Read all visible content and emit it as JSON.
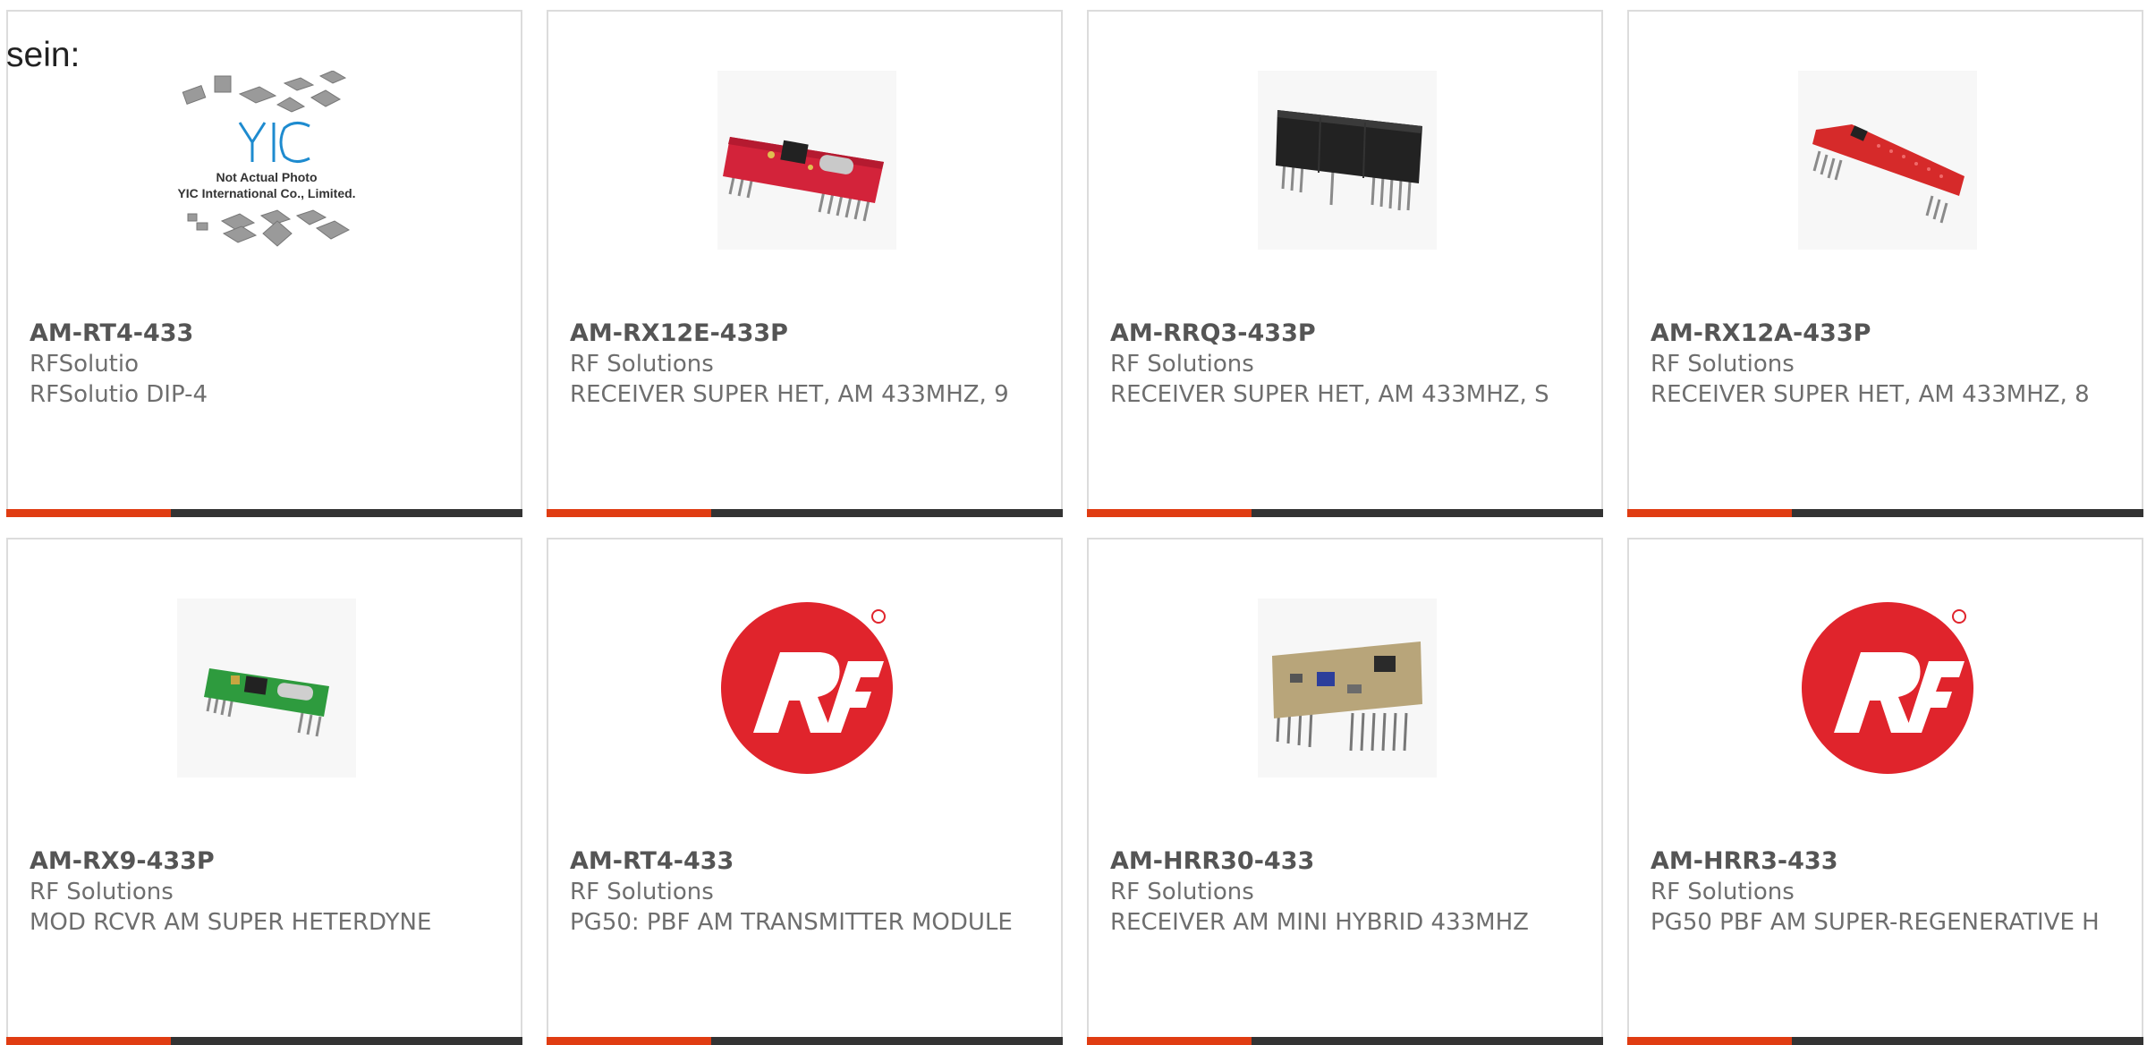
{
  "intro_text": "sein:",
  "accent_color": "#e03c12",
  "bar_color": "#333333",
  "products": [
    {
      "part": "AM-RT4-433",
      "manufacturer": "RFSolutio",
      "description": "RFSolutio DIP-4",
      "image": "yic-placeholder-photo",
      "image_text_line1": "Not Actual Photo",
      "image_text_line2": "YIC International Co., Limited.",
      "image_logo": "YIC"
    },
    {
      "part": "AM-RX12E-433P",
      "manufacturer": "RF Solutions",
      "description": "RECEIVER SUPER HET, AM 433MHZ, 9",
      "image": "red-receiver-module"
    },
    {
      "part": "AM-RRQ3-433P",
      "manufacturer": "RF Solutions",
      "description": "RECEIVER SUPER HET, AM 433MHZ, S",
      "image": "black-sip-module"
    },
    {
      "part": "AM-RX12A-433P",
      "manufacturer": "RF Solutions",
      "description": "RECEIVER SUPER HET, AM 433MHZ, 8",
      "image": "red-long-module"
    },
    {
      "part": "AM-RX9-433P",
      "manufacturer": "RF Solutions",
      "description": "MOD RCVR AM SUPER HETERDYNE",
      "image": "green-receiver-module"
    },
    {
      "part": "AM-RT4-433",
      "manufacturer": "RF Solutions",
      "description": "PG50: PBF AM TRANSMITTER MODULE",
      "image": "rf-solutions-logo"
    },
    {
      "part": "AM-HRR30-433",
      "manufacturer": "RF Solutions",
      "description": "RECEIVER AM MINI HYBRID 433MHZ",
      "image": "hybrid-receiver-module"
    },
    {
      "part": "AM-HRR3-433",
      "manufacturer": "RF Solutions",
      "description": "PG50 PBF AM SUPER-REGENERATIVE H",
      "image": "rf-solutions-logo"
    }
  ]
}
